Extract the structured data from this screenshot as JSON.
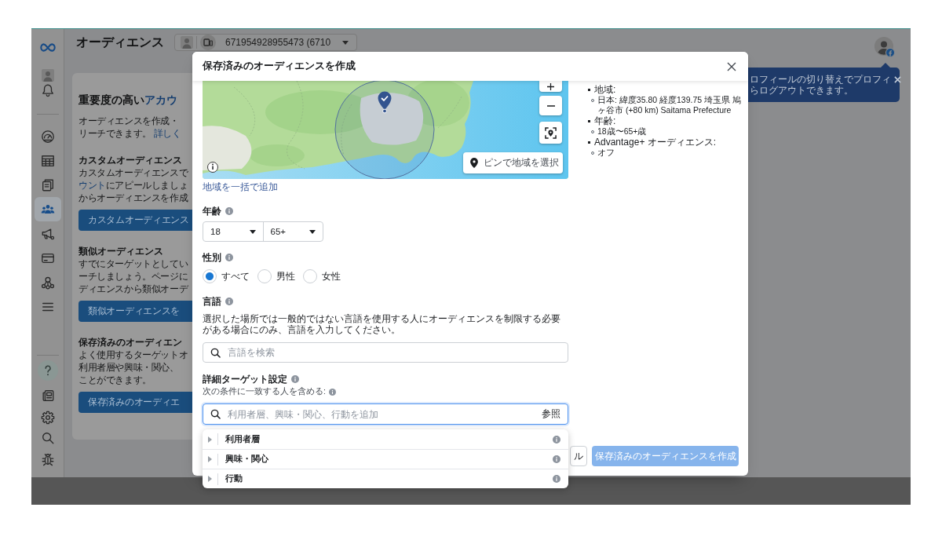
{
  "sidebar": {
    "nav": [
      {
        "selected": false
      },
      {
        "selected": false
      },
      {
        "selected": false
      },
      {
        "selected": true
      },
      {
        "selected": false
      },
      {
        "selected": false
      },
      {
        "selected": false
      },
      {
        "selected": false
      }
    ]
  },
  "header": {
    "title": "オーディエンス",
    "account": "671954928955473 (6710"
  },
  "intro_card": {
    "heading": [
      {
        "text": "重要度の高い",
        "link": false
      },
      {
        "text": "アカウ",
        "link": true
      }
    ],
    "paragraph": [
      [
        {
          "text": "オーディエンスを作成・",
          "link": false
        }
      ],
      [
        {
          "text": "リーチできます。 ",
          "link": false
        },
        {
          "text": "詳しく",
          "link": true
        }
      ]
    ],
    "sections": [
      {
        "title": "カスタムオーディエンス",
        "paragraph": [
          [
            {
              "text": "カスタムオーディエンスで",
              "link": false
            }
          ],
          [
            {
              "text": "ウント",
              "link": true
            },
            {
              "text": "にアピールしましょ",
              "link": false
            }
          ],
          [
            {
              "text": "からオーディエンスを作成",
              "link": false
            }
          ]
        ],
        "button": "カスタムオーディエンス"
      },
      {
        "title": "類似オーディエンス",
        "paragraph": [
          [
            {
              "text": "すでにターゲットとしてい",
              "link": false
            }
          ],
          [
            {
              "text": "ーチしましょう。ページに",
              "link": false
            }
          ],
          [
            {
              "text": "ディエンスから類似オーデ",
              "link": false
            }
          ]
        ],
        "button": "類似オーディエンスを"
      },
      {
        "title": "保存済みのオーディエン",
        "paragraph": [
          [
            {
              "text": "よく使用するターゲットオ",
              "link": false
            }
          ],
          [
            {
              "text": "利用者層や興味・関心、",
              "link": false
            }
          ],
          [
            {
              "text": "ことができます。",
              "link": false
            }
          ]
        ],
        "button": "保存済みのオーディエ"
      }
    ]
  },
  "tooltip": {
    "lines": [
      "ロフィールの切り替えでプロフィ",
      "らログアウトできます。"
    ]
  },
  "modal": {
    "title": "保存済みのオーディエンスを作成",
    "map": {
      "pin_button": "ピンで地域を選択"
    },
    "bulk_add_link": "地域を一括で追加",
    "age": {
      "label": "年齢",
      "min": "18",
      "max": "65+"
    },
    "gender": {
      "label": "性別",
      "options": [
        {
          "label": "すべて",
          "selected": true
        },
        {
          "label": "男性",
          "selected": false
        },
        {
          "label": "女性",
          "selected": false
        }
      ]
    },
    "language": {
      "label": "言語",
      "description": "選択した場所では一般的ではない言語を使用する人にオーディエンスを制限する必要がある場合にのみ、言語を入力してください。",
      "placeholder": "言語を検索"
    },
    "detailed_targeting": {
      "label": "詳細ターゲット設定",
      "sublabel": "次の条件に一致する人を含める:",
      "placeholder": "利用者層、興味・関心、行動を追加",
      "focused": true,
      "browse": "参照",
      "categories": [
        {
          "label": "利用者層",
          "expanded": false
        },
        {
          "label": "興味・関心",
          "expanded": false
        },
        {
          "label": "行動",
          "expanded": false
        }
      ]
    },
    "summary": [
      {
        "label": "地域:",
        "items": [
          "日本: 緯度35.80 経度139.75 埼玉県 鳩ヶ谷市 (+80 km) Saitama Prefecture"
        ]
      },
      {
        "label": "年齢:",
        "items": [
          "18歳〜65+歳"
        ]
      },
      {
        "label": "Advantage+ オーディエンス:",
        "items": [
          "オフ"
        ]
      }
    ],
    "buttons": {
      "cancel": "ル",
      "submit": "保存済みのオーディエンスを作成",
      "submit_disabled": true
    }
  }
}
